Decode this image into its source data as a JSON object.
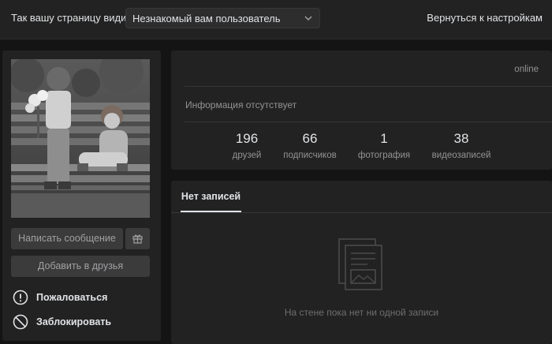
{
  "topbar": {
    "who_label": "Так вашу страницу видит",
    "viewer_select": "Незнакомый вам пользователь",
    "back_link": "Вернуться к настройкам"
  },
  "profile": {
    "avatar_alt": "photo-avatar",
    "buttons": {
      "message": "Написать сообщение",
      "add_friend": "Добавить в друзья"
    },
    "actions": {
      "report": "Пожаловаться",
      "block": "Заблокировать"
    }
  },
  "info": {
    "status": "online",
    "no_info": "Информация отсутствует",
    "counters": [
      {
        "value": "196",
        "label": "друзей"
      },
      {
        "value": "66",
        "label": "подписчиков"
      },
      {
        "value": "1",
        "label": "фотография"
      },
      {
        "value": "38",
        "label": "видеозаписей"
      }
    ]
  },
  "wall": {
    "tab": "Нет записей",
    "empty_text": "На стене пока нет ни одной записи"
  },
  "colors": {
    "background": "#141414",
    "card": "#222222",
    "button": "#3b3b3c",
    "text": "#e1e3e6",
    "muted": "#939393"
  }
}
